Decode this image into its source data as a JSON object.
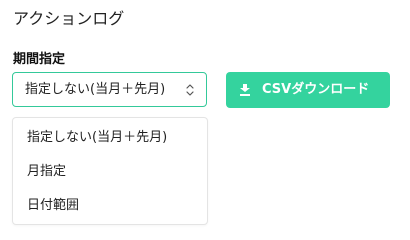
{
  "page": {
    "title": "アクションログ"
  },
  "filter": {
    "label": "期間指定",
    "selected": "指定しない(当月＋先月)",
    "options": [
      "指定しない(当月＋先月)",
      "月指定",
      "日付範囲"
    ]
  },
  "actions": {
    "csv_download_label": "CSVダウンロード",
    "csv_icon": "download-icon"
  },
  "colors": {
    "accent": "#34d39e",
    "select_border": "#34c99a"
  }
}
